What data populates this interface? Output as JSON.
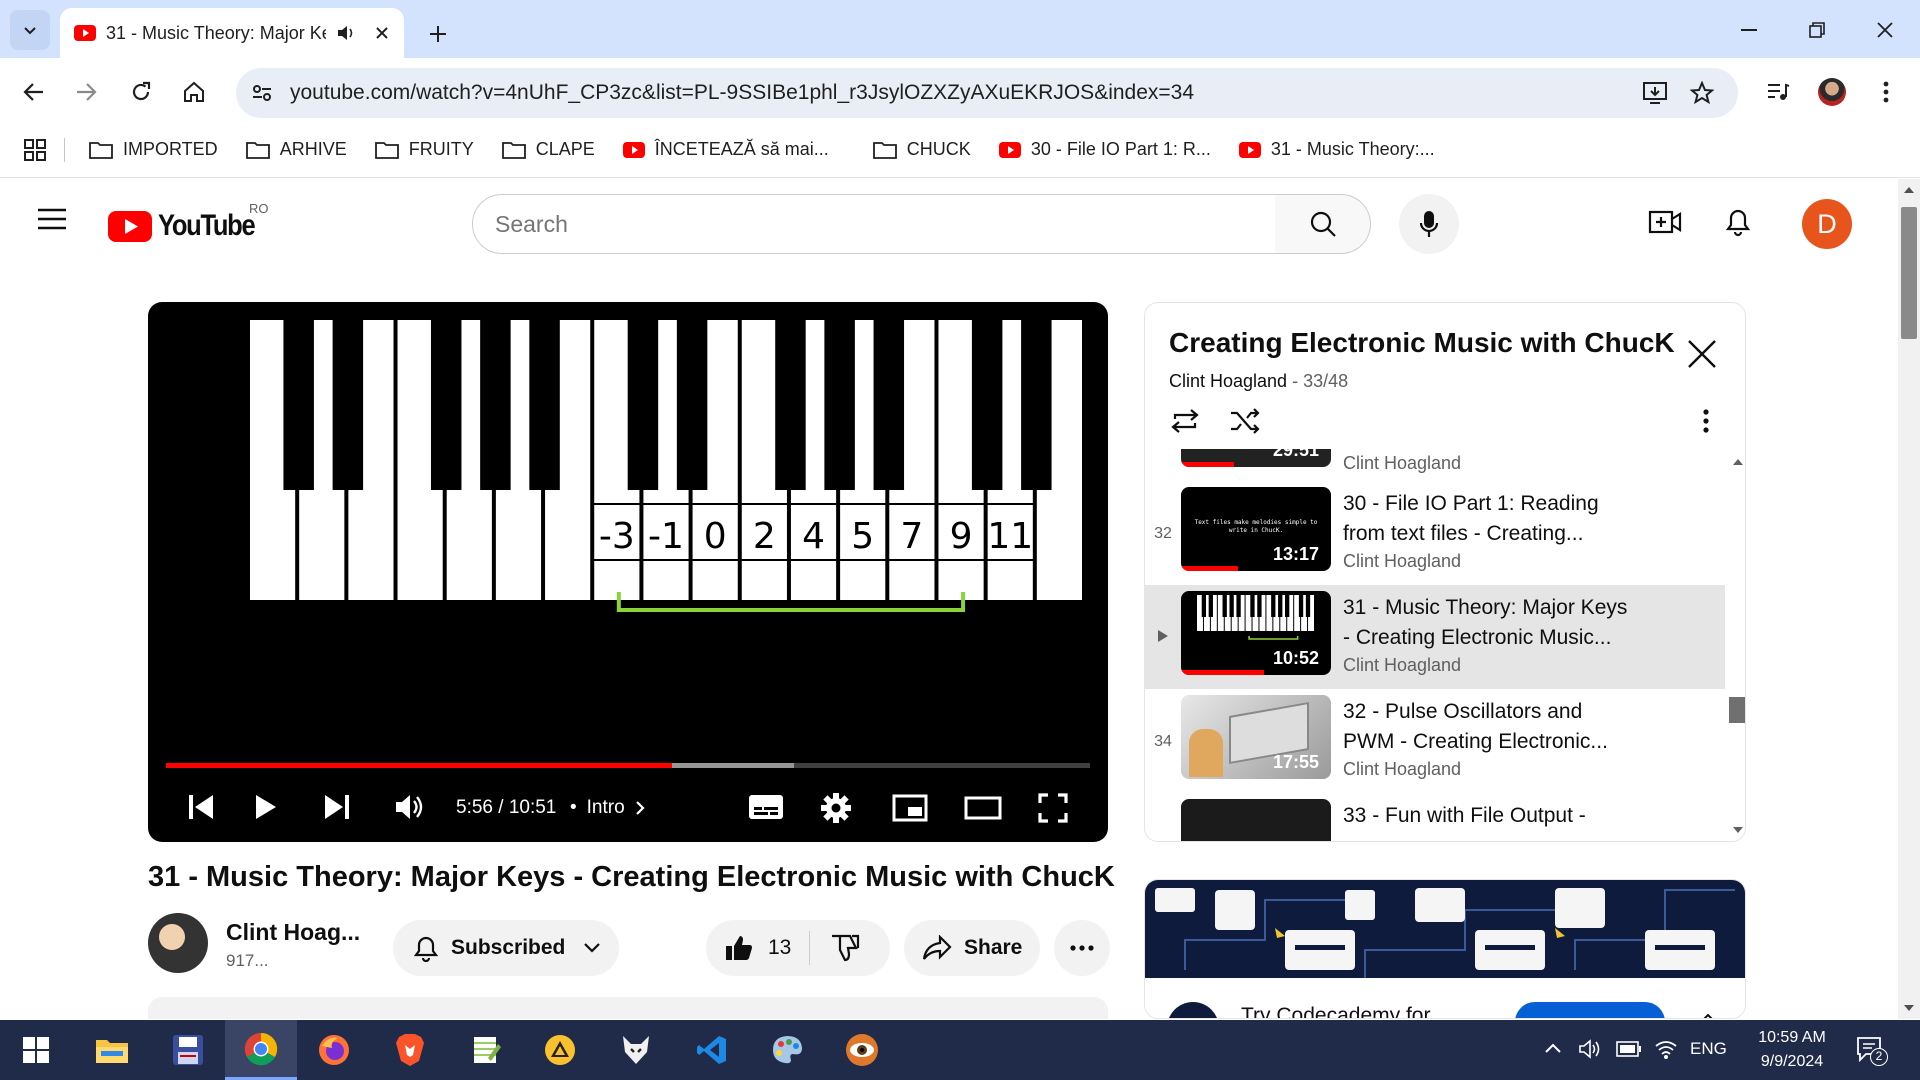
{
  "browser": {
    "tab_title": "31 - Music Theory: Major Ke",
    "url": "youtube.com/watch?v=4nUhF_CP3zc&list=PL-9SSIBe1phl_r3JsylOZXZyAXuEKRJOS&index=34",
    "bookmarks": [
      "IMPORTED",
      "ARHIVE",
      "FRUITY",
      "CLAPE",
      "ÎNCETEAZĂ să mai...",
      "CHUCK",
      "30 - File IO Part 1: R...",
      "31 - Music Theory:..."
    ]
  },
  "youtube": {
    "logo_text": "YouTube",
    "country_code": "RO",
    "search_placeholder": "Search",
    "avatar_letter": "D"
  },
  "player": {
    "key_numbers": [
      "-3",
      "-1",
      "0",
      "2",
      "4",
      "5",
      "7",
      "9",
      "11"
    ],
    "time": "5:56 / 10:51",
    "chapter": "Intro",
    "progress": 0.548
  },
  "video": {
    "title": "31 - Music Theory: Major Keys - Creating Electronic Music with ChucK",
    "channel": "Clint Hoag...",
    "subs": "917...",
    "subscribed_label": "Subscribed",
    "likes": "13",
    "share_label": "Share"
  },
  "playlist": {
    "title": "Creating Electronic Music with ChucK",
    "owner": "Clint Hoagland",
    "position": "33/48",
    "items": [
      {
        "idx": "",
        "title1": "",
        "title2": "",
        "channel": "Clint Hoagland",
        "duration": "29:51"
      },
      {
        "idx": "32",
        "title1": "30 - File IO Part 1: Reading",
        "title2": "from text files - Creating...",
        "channel": "Clint Hoagland",
        "duration": "13:17",
        "thumb_text": "Text files make melodies simple to write in ChucK."
      },
      {
        "idx": "",
        "title1": "31 - Music Theory: Major Keys",
        "title2": "- Creating Electronic Music...",
        "channel": "Clint Hoagland",
        "duration": "10:52"
      },
      {
        "idx": "34",
        "title1": "32 - Pulse Oscillators and",
        "title2": "PWM - Creating Electronic...",
        "channel": "Clint Hoagland",
        "duration": "17:55"
      },
      {
        "idx": "",
        "title1": "33 - Fun with File Output -",
        "title2": "",
        "channel": "",
        "duration": ""
      }
    ]
  },
  "ad": {
    "cta_text": "Try Codecademy for"
  },
  "taskbar": {
    "lang": "ENG",
    "time": "10:59 AM",
    "date": "9/9/2024",
    "notif_count": "2"
  }
}
